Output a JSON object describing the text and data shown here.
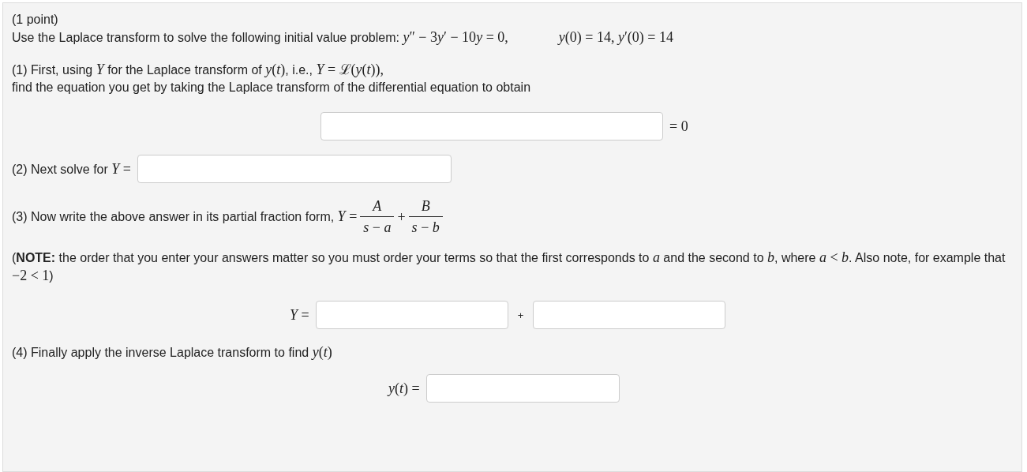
{
  "points": "(1 point)",
  "statement": {
    "segments": [
      {
        "kind": "text",
        "text": "Use the Laplace transform to solve the following initial value problem: "
      },
      {
        "kind": "math",
        "text": "*y*″ − 3"
      },
      {
        "kind": "var",
        "text": "y"
      },
      {
        "kind": "math",
        "text": "′ − 10"
      },
      {
        "kind": "var",
        "text": "y"
      },
      {
        "kind": "math",
        "text": " = 0,"
      }
    ],
    "initial_conditions": "*y*(0) = 14,  *y*′(0) = 14"
  },
  "step1": {
    "lines": [
      [
        {
          "kind": "text",
          "text": "(1) First, using "
        },
        {
          "kind": "math",
          "text": "*Y*"
        },
        {
          "kind": "text",
          "text": " for the Laplace transform of "
        },
        {
          "kind": "math",
          "text": "*y*(*t*)"
        },
        {
          "kind": "text",
          "text": ", i.e., "
        },
        {
          "kind": "math",
          "text": "*Y* = ℒ(*y*(*t*)),"
        }
      ],
      [
        {
          "kind": "text",
          "text": "find the equation you get by taking the Laplace transform of the differential equation to obtain"
        }
      ]
    ],
    "suffix": "= 0"
  },
  "step2": {
    "segments": [
      {
        "kind": "text",
        "text": "(2) Next solve for "
      },
      {
        "kind": "math",
        "text": "*Y* ="
      }
    ]
  },
  "step3": {
    "segments": [
      {
        "kind": "text",
        "text": "(3) Now write the above answer in its partial fraction form, "
      },
      {
        "kind": "math",
        "text": "*Y* ="
      }
    ],
    "terms": [
      {
        "numerator": "*A*",
        "denominator": "*s* − *a*"
      },
      {
        "numerator": "*B*",
        "denominator": "*s* − *b*"
      }
    ],
    "plus": "+"
  },
  "note": {
    "segments": [
      {
        "kind": "text",
        "text": "(**NOTE:** the order that you enter your answers matter so you must order your terms so that the first corresponds to "
      },
      {
        "kind": "math",
        "text": "*a*"
      },
      {
        "kind": "text",
        "text": " and the second to "
      },
      {
        "kind": "math",
        "text": "*b*"
      },
      {
        "kind": "text",
        "text": ", where "
      },
      {
        "kind": "math",
        "text": "*a* < *b*"
      },
      {
        "kind": "text",
        "text": ". Also note, for example that "
      },
      {
        "kind": "math",
        "text": "−2 < 1"
      },
      {
        "kind": "text",
        "text": ")"
      }
    ]
  },
  "answer_row": {
    "label": "*Y* =",
    "plus": "+"
  },
  "step4": {
    "segments": [
      {
        "kind": "text",
        "text": "(4) Finally apply the inverse Laplace transform to find "
      },
      {
        "kind": "math",
        "text": "*y*(*t*)"
      }
    ],
    "label": "*y*(*t*) ="
  }
}
